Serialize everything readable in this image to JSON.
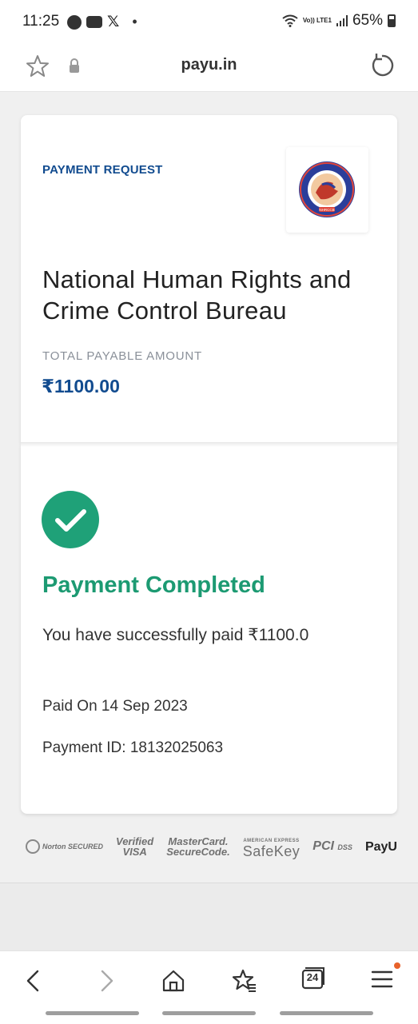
{
  "status_bar": {
    "time": "11:25",
    "volte_label": "Vo)) LTE1",
    "battery": "65%"
  },
  "browser": {
    "url": "payu.in"
  },
  "request": {
    "label": "PAYMENT REQUEST",
    "merchant_name": "National Human Rights and Crime Control Bureau",
    "logo_text": "NHRCCB",
    "total_label": "TOTAL PAYABLE AMOUNT",
    "amount": "₹1100.00"
  },
  "result": {
    "title": "Payment Completed",
    "message": "You have successfully paid ₹1100.0",
    "paid_on": "Paid On 14 Sep 2023",
    "payment_id": "Payment ID: 18132025063"
  },
  "trust_badges": {
    "norton": "Norton SECURED",
    "visa_line1": "Verified",
    "visa_line2": "VISA",
    "mc_line1": "MasterCard.",
    "mc_line2": "SecureCode.",
    "amex": "AMERICAN EXPRESS",
    "safekey": "SafeKey",
    "pci": "PCI",
    "dss": "DSS",
    "payu": "PayU"
  },
  "bottom_nav": {
    "tabs_count": "24"
  },
  "colors": {
    "brand_blue": "#114b8f",
    "success_green": "#1c9a72",
    "notification": "#e8622a"
  }
}
